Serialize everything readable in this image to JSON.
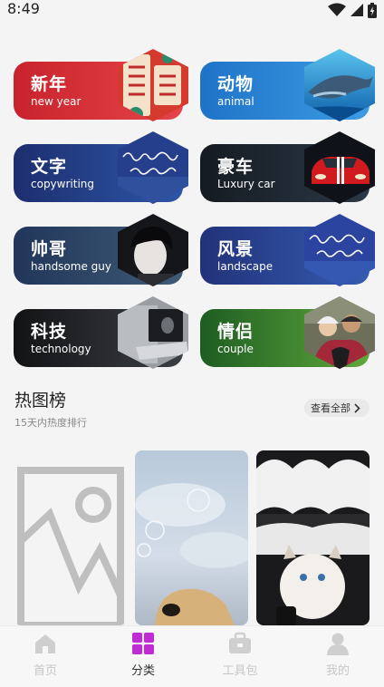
{
  "status": {
    "time": "8:49"
  },
  "categories": [
    {
      "title": "新年",
      "subtitle": "new year",
      "colors": [
        "#c8232c",
        "#e5444a"
      ]
    },
    {
      "title": "动物",
      "subtitle": "animal",
      "colors": [
        "#1f73c7",
        "#3d9be4"
      ]
    },
    {
      "title": "文字",
      "subtitle": "copywriting",
      "colors": [
        "#1d2e6e",
        "#2d57a8"
      ]
    },
    {
      "title": "豪车",
      "subtitle": "Luxury car",
      "colors": [
        "#151b22",
        "#2b3845"
      ]
    },
    {
      "title": "帅哥",
      "subtitle": "handsome guy",
      "colors": [
        "#21365a",
        "#405a76"
      ]
    },
    {
      "title": "风景",
      "subtitle": "landscape",
      "colors": [
        "#22327a",
        "#355cb0"
      ]
    },
    {
      "title": "科技",
      "subtitle": "technology",
      "colors": [
        "#121315",
        "#3c3f44"
      ]
    },
    {
      "title": "情侣",
      "subtitle": "couple",
      "colors": [
        "#1d5d22",
        "#5fa83b"
      ]
    }
  ],
  "hot": {
    "title": "热图榜",
    "subtitle": "15天内热度排行",
    "view_all": "查看全部"
  },
  "tabs": [
    {
      "label": "首页",
      "icon": "home-icon",
      "active": false
    },
    {
      "label": "分类",
      "icon": "category-icon",
      "active": true
    },
    {
      "label": "工具包",
      "icon": "toolbox-icon",
      "active": false
    },
    {
      "label": "我的",
      "icon": "profile-icon",
      "active": false
    }
  ],
  "colors": {
    "active_tab": "#c02bd6",
    "inactive_tab": "#cfcfcf"
  }
}
